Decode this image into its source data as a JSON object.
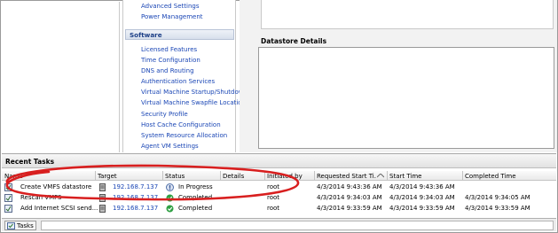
{
  "settings_links_top": [
    "Advanced Settings",
    "Power Management"
  ],
  "software_section": {
    "title": "Software",
    "links": [
      "Licensed Features",
      "Time Configuration",
      "DNS and Routing",
      "Authentication Services",
      "Virtual Machine Startup/Shutdown",
      "Virtual Machine Swapfile Location",
      "Security Profile",
      "Host Cache Configuration",
      "System Resource Allocation",
      "Agent VM Settings"
    ]
  },
  "datastore_details": {
    "title": "Datastore Details"
  },
  "recent_tasks": {
    "title": "Recent Tasks",
    "columns": [
      "Name",
      "Target",
      "Status",
      "Details",
      "Initiated by",
      "Requested Start Ti...",
      "Start Time",
      "Completed Time"
    ],
    "rows": [
      {
        "name": "Create VMFS datastore",
        "target": "192.168.7.137",
        "status": "In Progress",
        "status_icon": "in-progress-icon",
        "details": "",
        "initiated_by": "root",
        "requested_start": "4/3/2014 9:43:36 AM",
        "start_time": "4/3/2014 9:43:36 AM",
        "completed_time": ""
      },
      {
        "name": "Rescan VMFS",
        "target": "192.168.7.137",
        "status": "Completed",
        "status_icon": "check-icon",
        "details": "",
        "initiated_by": "root",
        "requested_start": "4/3/2014 9:34:03 AM",
        "start_time": "4/3/2014 9:34:03 AM",
        "completed_time": "4/3/2014 9:34:05 AM"
      },
      {
        "name": "Add Internet SCSI send...",
        "target": "192.168.7.137",
        "status": "Completed",
        "status_icon": "check-icon",
        "details": "",
        "initiated_by": "root",
        "requested_start": "4/3/2014 9:33:59 AM",
        "start_time": "4/3/2014 9:33:59 AM",
        "completed_time": "4/3/2014 9:33:59 AM"
      }
    ]
  },
  "status_bar": {
    "tasks_tab": "Tasks"
  },
  "colors": {
    "link": "#1a46b5",
    "annotation": "#d81f1f",
    "success": "#2ea043"
  }
}
